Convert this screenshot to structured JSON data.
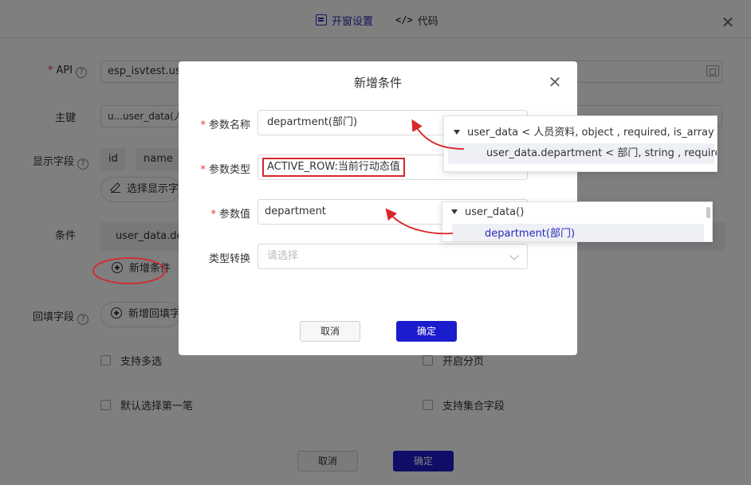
{
  "bg": {
    "tabs": {
      "open": "开窗设置",
      "code": "代码"
    },
    "labels": {
      "api": "API",
      "primary_key": "主键",
      "display_fields": "显示字段",
      "condition": "条件",
      "backfill": "回填字段"
    },
    "api_value": "esp_isvtest.use",
    "primary_key_value": "u...user_data(人...",
    "display_chips": [
      "id",
      "name"
    ],
    "select_display_btn": "选择显示字",
    "condition_value": "user_data.de",
    "add_condition_btn": "新增条件",
    "add_backfill_btn": "新增回填字",
    "checkboxes": {
      "multi": "支持多选",
      "paging": "开启分页",
      "default_first": "默认选择第一笔",
      "collection": "支持集合字段"
    },
    "footer": {
      "cancel": "取消",
      "ok": "确定"
    }
  },
  "modal": {
    "title": "新增条件",
    "fields": {
      "param_name_label": "参数名称",
      "param_name_value": "department(部门)",
      "param_type_label": "参数类型",
      "param_type_value": "ACTIVE_ROW:当前行动态值",
      "param_value_label": "参数值",
      "param_value_value": "department",
      "type_convert_label": "类型转换",
      "type_convert_placeholder": "请选择"
    },
    "buttons": {
      "cancel": "取消",
      "ok": "确定"
    }
  },
  "tree1": {
    "root": "user_data < 人员资料, object , required, is_array >",
    "child": "user_data.department < 部门, string , required, is"
  },
  "tree2": {
    "root": "user_data()",
    "child": "department(部门)"
  },
  "colors": {
    "accent": "#1c1ccf",
    "annotation": "#d9262b"
  }
}
